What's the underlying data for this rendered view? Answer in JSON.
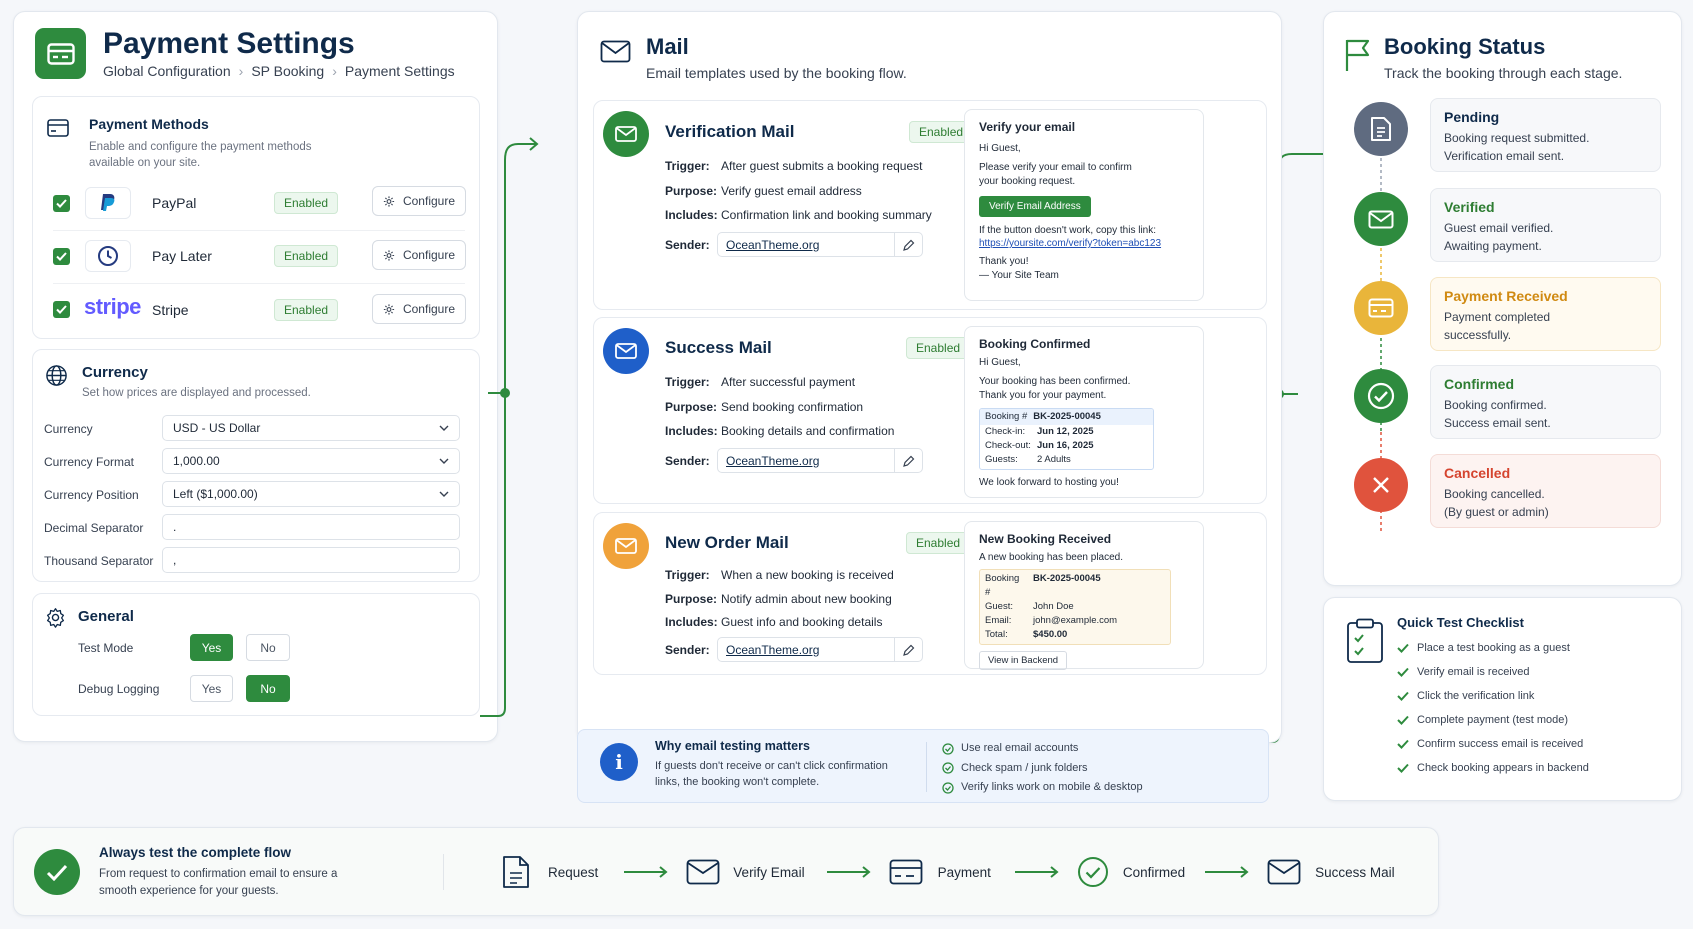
{
  "payment": {
    "title": "Payment Settings",
    "breadcrumb": [
      "Global Configuration",
      "SP Booking",
      "Payment Settings"
    ],
    "methods": {
      "title": "Payment Methods",
      "desc": "Enable and configure the payment methods available on your site.",
      "items": [
        {
          "name": "PayPal",
          "status": "Enabled",
          "action": "Configure"
        },
        {
          "name": "Pay Later",
          "status": "Enabled",
          "action": "Configure"
        },
        {
          "name": "Stripe",
          "status": "Enabled",
          "action": "Configure",
          "logo": "stripe"
        }
      ]
    },
    "currency": {
      "title": "Currency",
      "desc": "Set how prices are displayed and processed.",
      "fields": [
        {
          "label": "Currency",
          "value": "USD - US Dollar"
        },
        {
          "label": "Currency Format",
          "value": "1,000.00"
        },
        {
          "label": "Currency Position",
          "value": "Left ($1,000.00)"
        },
        {
          "label": "Decimal Separator",
          "value": "."
        },
        {
          "label": "Thousand Separator",
          "value": ","
        }
      ]
    },
    "general": {
      "title": "General",
      "test_mode": {
        "label": "Test Mode",
        "yes": "Yes",
        "no": "No",
        "selected": "Yes"
      },
      "debug_logging": {
        "label": "Debug Logging",
        "yes": "Yes",
        "no": "No",
        "selected": "No"
      }
    }
  },
  "mail": {
    "title": "Mail",
    "subtitle": "Email templates used by the booking flow.",
    "labels": {
      "trigger": "Trigger:",
      "purpose": "Purpose:",
      "includes": "Includes:",
      "sender": "Sender:"
    },
    "templates": [
      {
        "name": "Verification Mail",
        "status": "Enabled",
        "trigger": "After guest submits a booking request",
        "purpose": "Verify guest email address",
        "includes": "Confirmation link and booking summary",
        "sender": "OceanTheme.org",
        "preview": {
          "title": "Verify your email",
          "greeting": "Hi Guest,",
          "body": "Please verify your email to confirm your booking request.",
          "button": "Verify Email Address",
          "fallback": "If the button doesn't work, copy this link:",
          "link": "https://yoursite.com/verify?token=abc123",
          "thanks": "Thank you!",
          "sign": "— Your Site Team"
        }
      },
      {
        "name": "Success Mail",
        "status": "Enabled",
        "trigger": "After successful payment",
        "purpose": "Send booking confirmation",
        "includes": "Booking details and confirmation",
        "sender": "OceanTheme.org",
        "preview": {
          "title": "Booking Confirmed",
          "greeting": "Hi Guest,",
          "body": "Your booking has been confirmed. Thank you for your payment.",
          "booking_label": "Booking #",
          "booking_no": "BK-2025-00045",
          "checkin_label": "Check-in:",
          "checkin": "Jun 12, 2025",
          "checkout_label": "Check-out:",
          "checkout": "Jun 16, 2025",
          "guests_label": "Guests:",
          "guests": "2 Adults",
          "closing": "We look forward to hosting you!"
        }
      },
      {
        "name": "New Order Mail",
        "status": "Enabled",
        "trigger": "When a new booking is received",
        "purpose": "Notify admin about new booking",
        "includes": "Guest info and booking details",
        "sender": "OceanTheme.org",
        "preview": {
          "title": "New Booking Received",
          "body": "A new booking has been placed.",
          "booking_label": "Booking #",
          "booking_no": "BK-2025-00045",
          "guest_label": "Guest:",
          "guest": "John Doe",
          "email_label": "Email:",
          "email": "john@example.com",
          "total_label": "Total:",
          "total": "$450.00",
          "button": "View in Backend"
        }
      }
    ],
    "info": {
      "title": "Why email testing matters",
      "body": "If guests don't receive or can't click confirmation links, the booking won't complete.",
      "tips": [
        "Use real email accounts",
        "Check spam / junk folders",
        "Verify links work on mobile & desktop"
      ]
    }
  },
  "status": {
    "title": "Booking Status",
    "subtitle": "Track the booking through each stage.",
    "stages": [
      {
        "name": "Pending",
        "desc": "Booking request submitted. Verification email sent.",
        "color": "#5f6b80"
      },
      {
        "name": "Verified",
        "desc": "Guest email verified. Awaiting payment.",
        "color": "#2e8b3e"
      },
      {
        "name": "Payment Received",
        "desc": "Payment completed successfully.",
        "color": "#e9b53a"
      },
      {
        "name": "Confirmed",
        "desc": "Booking confirmed. Success email sent.",
        "color": "#2e8b3e"
      },
      {
        "name": "Cancelled",
        "desc": "Booking cancelled. (By guest or admin)",
        "color": "#e0533d"
      }
    ],
    "checklist": {
      "title": "Quick Test Checklist",
      "items": [
        "Place a test booking as a guest",
        "Verify email is received",
        "Click the verification link",
        "Complete payment (test mode)",
        "Confirm success email is received",
        "Check booking appears in backend"
      ]
    }
  },
  "footer": {
    "title": "Always test the complete flow",
    "body": "From request to confirmation email to ensure a smooth experience for your guests.",
    "steps": [
      "Request",
      "Verify Email",
      "Payment",
      "Confirmed",
      "Success Mail"
    ]
  }
}
